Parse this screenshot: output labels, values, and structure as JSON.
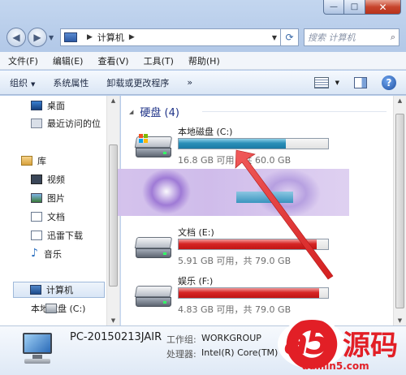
{
  "window": {
    "caption_buttons": {
      "minimize": "—",
      "maximize": "□",
      "close": "✕"
    }
  },
  "nav": {
    "back_glyph": "◀",
    "forward_glyph": "▶",
    "address_crumb": "计算机",
    "search_placeholder": "搜索 计算机",
    "search_icon_glyph": "⌕",
    "refresh_glyph": "⟳"
  },
  "menu": {
    "items": [
      "文件(F)",
      "编辑(E)",
      "查看(V)",
      "工具(T)",
      "帮助(H)"
    ]
  },
  "commands": {
    "organize": "组织",
    "system_properties": "系统属性",
    "uninstall": "卸载或更改程序",
    "more": "»",
    "help_glyph": "?"
  },
  "sidebar": {
    "favorites": [
      {
        "label": "桌面",
        "icon": "desktop-icon"
      },
      {
        "label": "最近访问的位",
        "icon": "recent-places-icon"
      }
    ],
    "libraries_label": "库",
    "libraries": [
      {
        "label": "视频",
        "icon": "video-icon"
      },
      {
        "label": "图片",
        "icon": "pictures-icon"
      },
      {
        "label": "文档",
        "icon": "documents-icon"
      },
      {
        "label": "迅雷下载",
        "icon": "download-folder-icon"
      },
      {
        "label": "音乐",
        "icon": "music-icon"
      }
    ],
    "computer_label": "计算机",
    "computer_children": [
      {
        "label": "本地磁盘 (C:)",
        "icon": "drive-icon"
      }
    ]
  },
  "content": {
    "group_title": "硬盘 (4)",
    "drives": [
      {
        "name": "本地磁盘 (C:)",
        "info": "16.8 GB 可用，共 60.0 GB",
        "used_fraction": 0.72,
        "color": "#1a7aa4"
      },
      {
        "name": "文档 (E:)",
        "info": "5.91 GB 可用，共 79.0 GB",
        "used_fraction": 0.925,
        "color": "#c01414"
      },
      {
        "name": "娱乐 (F:)",
        "info": "4.83 GB 可用，共 79.0 GB",
        "used_fraction": 0.939,
        "color": "#c01414"
      }
    ]
  },
  "details": {
    "pc_name": "PC-20150213JAIR",
    "workgroup_label": "工作组:",
    "workgroup_value": "WORKGROUP",
    "processor_label": "处理器:",
    "processor_value": "Intel(R) Core(TM)"
  },
  "watermark": {
    "logo": "a5",
    "brand": "源码",
    "url": "admin5.com",
    "color": "#e21f26"
  }
}
